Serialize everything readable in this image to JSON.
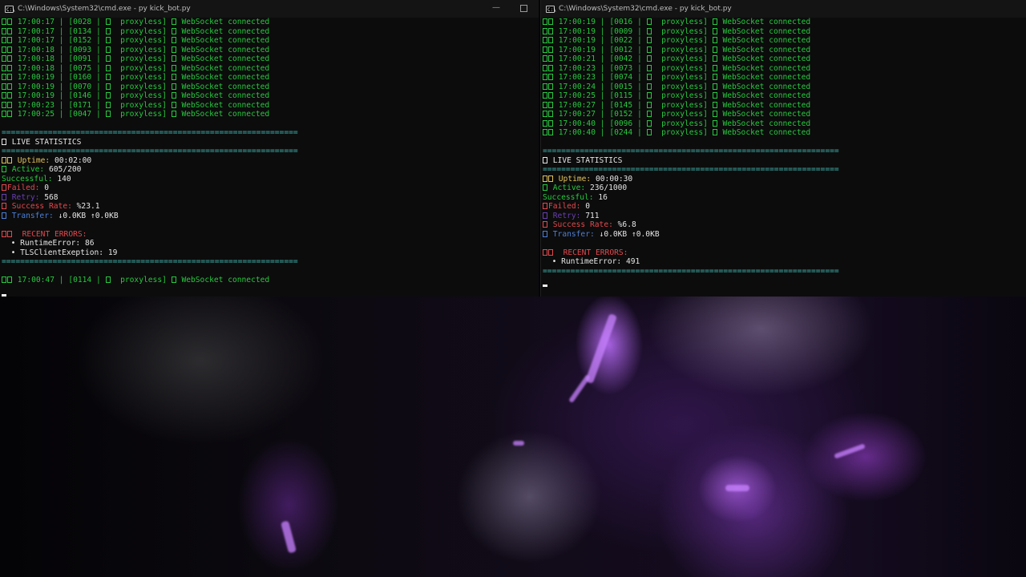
{
  "left_window": {
    "title": "C:\\Windows\\System32\\cmd.exe - py  kick_bot.py",
    "log_lines": [
      {
        "time": "17:00:17",
        "id": "[0028",
        "mode": "proxyless]",
        "msg": "WebSocket connected"
      },
      {
        "time": "17:00:17",
        "id": "[0134",
        "mode": "proxyless]",
        "msg": "WebSocket connected"
      },
      {
        "time": "17:00:17",
        "id": "[0152",
        "mode": "proxyless]",
        "msg": "WebSocket connected"
      },
      {
        "time": "17:00:18",
        "id": "[0093",
        "mode": "proxyless]",
        "msg": "WebSocket connected"
      },
      {
        "time": "17:00:18",
        "id": "[0091",
        "mode": "proxyless]",
        "msg": "WebSocket connected"
      },
      {
        "time": "17:00:18",
        "id": "[0075",
        "mode": "proxyless]",
        "msg": "WebSocket connected"
      },
      {
        "time": "17:00:19",
        "id": "[0160",
        "mode": "proxyless]",
        "msg": "WebSocket connected"
      },
      {
        "time": "17:00:19",
        "id": "[0070",
        "mode": "proxyless]",
        "msg": "WebSocket connected"
      },
      {
        "time": "17:00:19",
        "id": "[0146",
        "mode": "proxyless]",
        "msg": "WebSocket connected"
      },
      {
        "time": "17:00:23",
        "id": "[0171",
        "mode": "proxyless]",
        "msg": "WebSocket connected"
      },
      {
        "time": "17:00:25",
        "id": "[0047",
        "mode": "proxyless]",
        "msg": "WebSocket connected"
      }
    ],
    "separator": "================================================================",
    "stats_header": "LIVE STATISTICS",
    "uptime_label": "Uptime:",
    "uptime_value": "00:02:00",
    "active_label": "Active:",
    "active_value": "605/200",
    "successful_label": "Successful:",
    "successful_value": "140",
    "failed_label": "Failed:",
    "failed_value": "0",
    "retry_label": "Retry:",
    "retry_value": "568",
    "rate_label": "Success Rate:",
    "rate_value": "%23.1",
    "transfer_label": "Transfer:",
    "transfer_value": "↓0.0KB ↑0.0KB",
    "errors_header": "RECENT ERRORS:",
    "errors": [
      "• RuntimeError: 86",
      "• TLSClientExeption: 19"
    ],
    "last_line": {
      "time": "17:00:47",
      "id": "[0114",
      "mode": "proxyless]",
      "msg": "WebSocket connected"
    }
  },
  "right_window": {
    "title": "C:\\Windows\\System32\\cmd.exe - py  kick_bot.py",
    "log_lines": [
      {
        "time": "17:00:19",
        "id": "[0016",
        "mode": "proxyless]",
        "msg": "WebSocket connected"
      },
      {
        "time": "17:00:19",
        "id": "[0009",
        "mode": "proxyless]",
        "msg": "WebSocket connected"
      },
      {
        "time": "17:00:19",
        "id": "[0022",
        "mode": "proxyless]",
        "msg": "WebSocket connected"
      },
      {
        "time": "17:00:19",
        "id": "[0012",
        "mode": "proxyless]",
        "msg": "WebSocket connected"
      },
      {
        "time": "17:00:21",
        "id": "[0042",
        "mode": "proxyless]",
        "msg": "WebSocket connected"
      },
      {
        "time": "17:00:23",
        "id": "[0073",
        "mode": "proxyless]",
        "msg": "WebSocket connected"
      },
      {
        "time": "17:00:23",
        "id": "[0074",
        "mode": "proxyless]",
        "msg": "WebSocket connected"
      },
      {
        "time": "17:00:24",
        "id": "[0015",
        "mode": "proxyless]",
        "msg": "WebSocket connected"
      },
      {
        "time": "17:00:25",
        "id": "[0115",
        "mode": "proxyless]",
        "msg": "WebSocket connected"
      },
      {
        "time": "17:00:27",
        "id": "[0145",
        "mode": "proxyless]",
        "msg": "WebSocket connected"
      },
      {
        "time": "17:00:27",
        "id": "[0152",
        "mode": "proxyless]",
        "msg": "WebSocket connected"
      },
      {
        "time": "17:00:40",
        "id": "[0096",
        "mode": "proxyless]",
        "msg": "WebSocket connected"
      },
      {
        "time": "17:00:40",
        "id": "[0244",
        "mode": "proxyless]",
        "msg": "WebSocket connected"
      }
    ],
    "separator": "================================================================",
    "stats_header": "LIVE STATISTICS",
    "uptime_label": "Uptime:",
    "uptime_value": "00:00:30",
    "active_label": "Active:",
    "active_value": "236/1000",
    "successful_label": "Successful:",
    "successful_value": "16",
    "failed_label": "Failed:",
    "failed_value": "0",
    "retry_label": "Retry:",
    "retry_value": "711",
    "rate_label": "Success Rate:",
    "rate_value": "%6.8",
    "transfer_label": "Transfer:",
    "transfer_value": "↓0.0KB ↑0.0KB",
    "errors_header": "RECENT ERRORS:",
    "errors": [
      "• RuntimeError: 491"
    ]
  },
  "icons": {
    "window_icon": "cmd-icon",
    "minimize": "minimize-icon",
    "maximize": "maximize-icon",
    "line_status": "status-glyph-icon"
  },
  "colors": {
    "terminal_bg": "#0c0c0c",
    "log_green": "#27c93f",
    "separator_cyan": "#3fb6b0",
    "error_red": "#e5484d",
    "retry_purple": "#6a3fb0",
    "transfer_blue": "#4c7fd8",
    "uptime_yellow": "#e0c15a"
  }
}
